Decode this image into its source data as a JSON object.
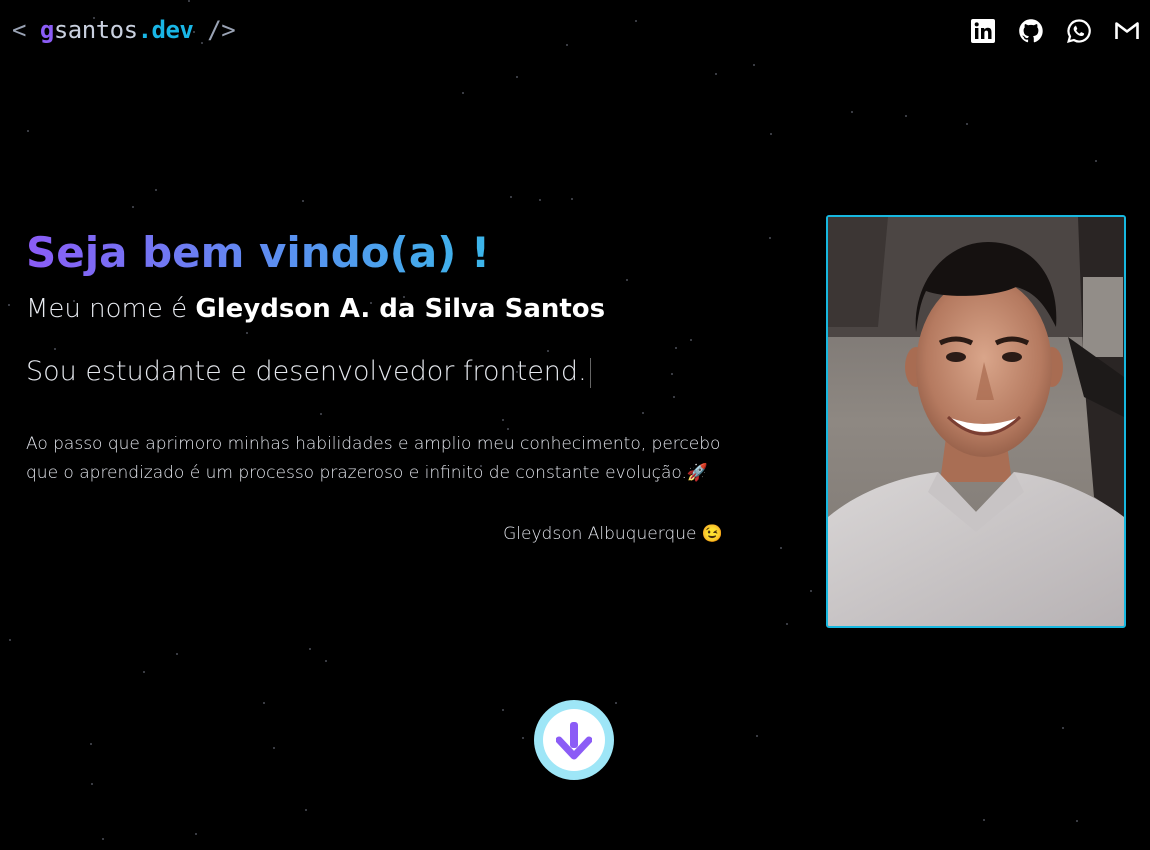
{
  "header": {
    "logo": {
      "open": "< ",
      "first": "g",
      "middle": "santos",
      "suffix": ".dev",
      "close": " />"
    },
    "socials": [
      {
        "name": "linkedin",
        "icon": "linkedin-icon"
      },
      {
        "name": "github",
        "icon": "github-icon"
      },
      {
        "name": "whatsapp",
        "icon": "whatsapp-icon"
      },
      {
        "name": "gmail",
        "icon": "gmail-icon"
      }
    ]
  },
  "hero": {
    "welcome": "Seja bem vindo(a) !",
    "intro_prefix": "Meu nome é ",
    "intro_name": "Gleydson A. da Silva Santos",
    "role": "Sou estudante e desenvolvedor frontend.",
    "description": "Ao passo que aprimoro minhas habilidades e amplio meu conhecimento, percebo que o aprendizado é um processo prazeroso e infinito de constante evolução.🚀",
    "signature": "Gleydson Albuquerque 😉"
  },
  "photo": {
    "icon": "profile-photo"
  },
  "scroll_button": {
    "icon": "arrow-down-icon"
  },
  "colors": {
    "accent_purple": "#8b5cf6",
    "accent_cyan": "#19b6e6",
    "background": "#000000"
  }
}
